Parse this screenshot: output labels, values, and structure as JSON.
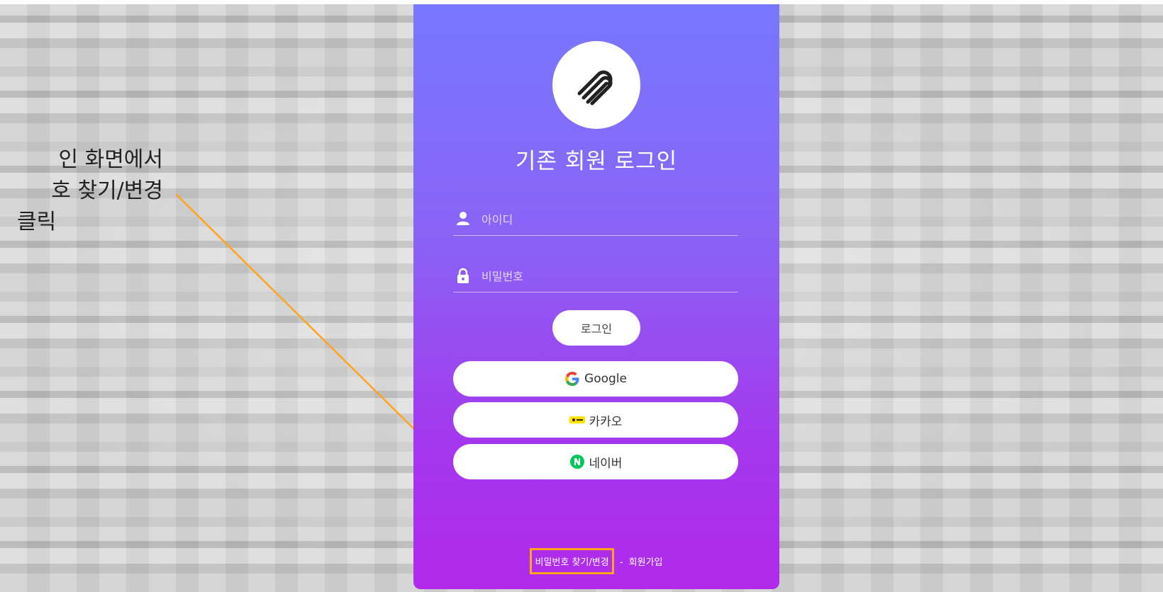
{
  "annotation": {
    "line1": "인 화면에서",
    "line2": "호 찾기/변경",
    "line3": "클릭",
    "callout_color": "#ffa31a"
  },
  "login": {
    "logo_icon": "paperclip-icon",
    "title": "기존 회원 로그인",
    "id_placeholder": "아이디",
    "id_value": "",
    "password_placeholder": "비밀번호",
    "password_value": "",
    "login_button": "로그인",
    "social": [
      {
        "label": "Google",
        "icon": "google-icon"
      },
      {
        "label": "카카오",
        "icon": "kakao-icon"
      },
      {
        "label": "네이버",
        "icon": "naver-icon"
      }
    ],
    "find_password_link": "비밀번호 찾기/변경",
    "separator": "-",
    "signup_link": "회원가입"
  },
  "colors": {
    "panel_top": "#7878ff",
    "panel_bottom": "#b12aec",
    "highlight": "#ffa31a",
    "naver_green": "#03c75a",
    "kakao_yellow": "#fee500"
  }
}
